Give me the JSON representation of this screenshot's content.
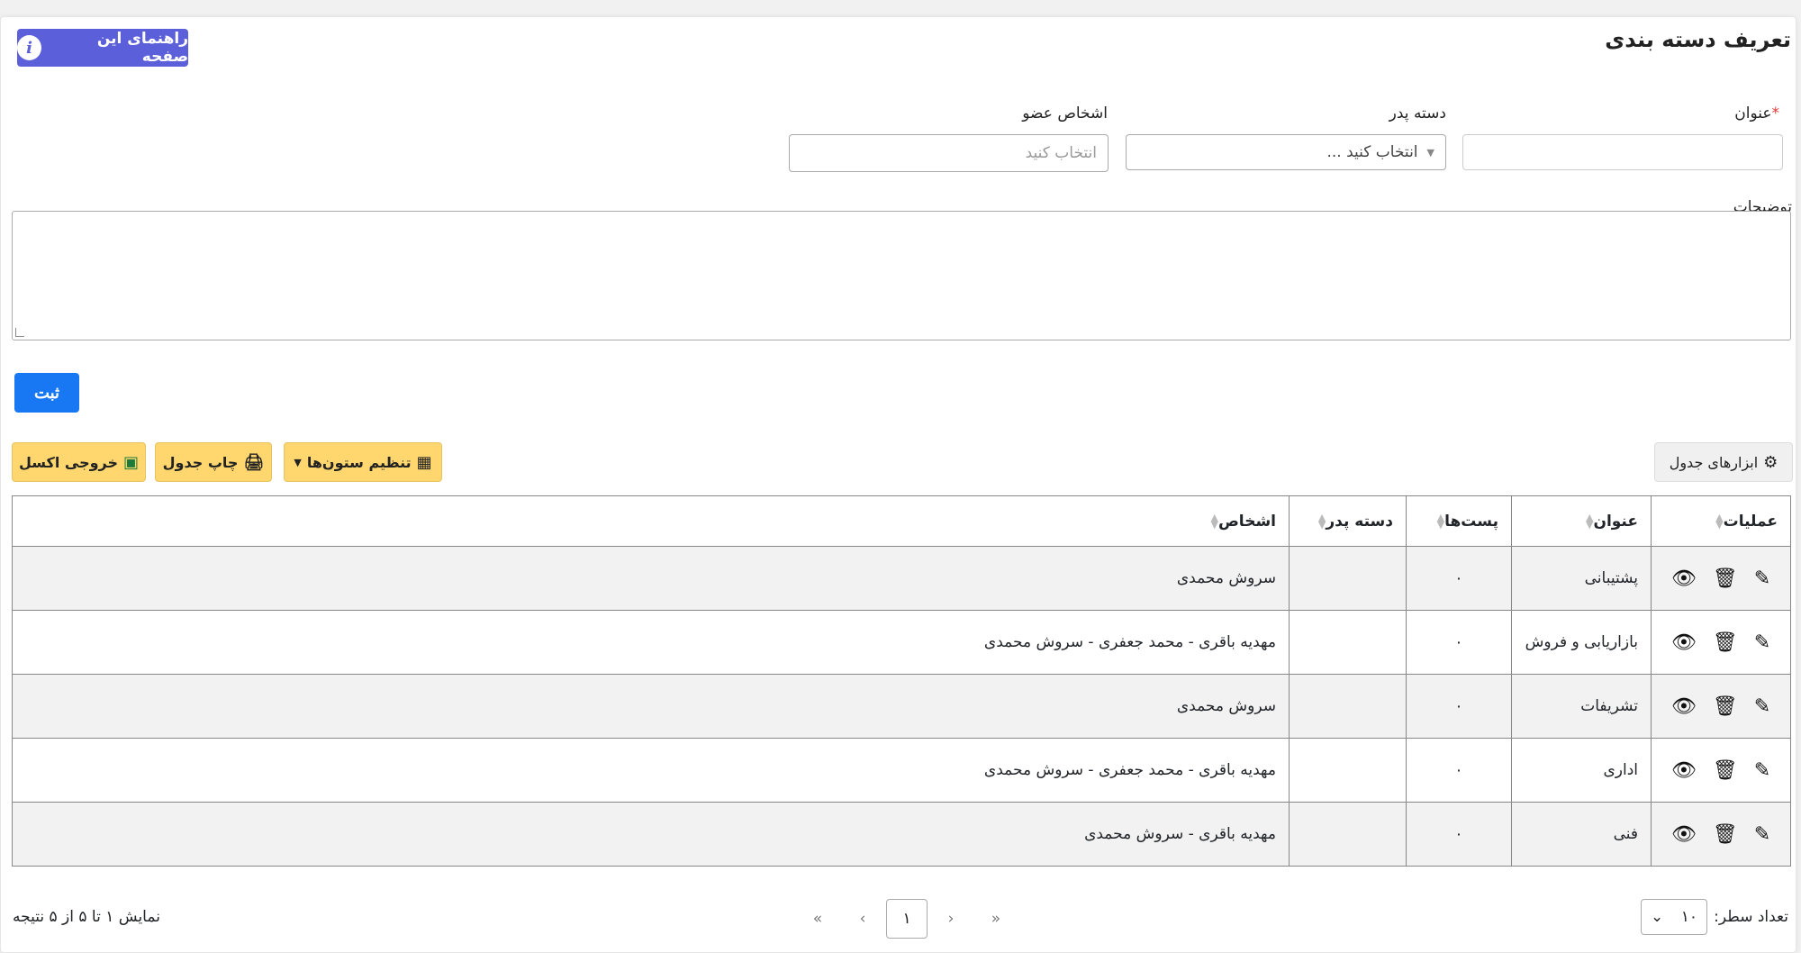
{
  "page": {
    "title": "تعریف دسته بندی",
    "help_button": "راهنمای این صفحه"
  },
  "form": {
    "title_label": "عنوان",
    "required_mark": "*",
    "parent_label": "دسته پدر",
    "parent_placeholder": "انتخاب کنید ...",
    "members_label": "اشخاص عضو",
    "members_placeholder": "انتخاب کنید",
    "description_label": "توضیحات",
    "submit_label": "ثبت"
  },
  "toolbar": {
    "table_tools": "ابزارهای جدول",
    "column_settings": "تنظیم ستون‌ها",
    "print_table": "چاپ جدول",
    "excel_export": "خروجی اکسل"
  },
  "table": {
    "headers": {
      "operations": "عملیات",
      "title": "عنوان",
      "posts": "پست‌ها",
      "parent": "دسته پدر",
      "persons": "اشخاص"
    },
    "rows": [
      {
        "title": "پشتیبانی",
        "posts": "۰",
        "parent": "",
        "persons": "سروش محمدی"
      },
      {
        "title": "بازاریابی و فروش",
        "posts": "۰",
        "parent": "",
        "persons": "مهدیه باقری - محمد جعفری - سروش محمدی"
      },
      {
        "title": "تشریفات",
        "posts": "۰",
        "parent": "",
        "persons": "سروش محمدی"
      },
      {
        "title": "اداری",
        "posts": "۰",
        "parent": "",
        "persons": "مهدیه باقری - محمد جعفری - سروش محمدی"
      },
      {
        "title": "فنی",
        "posts": "۰",
        "parent": "",
        "persons": "مهدیه باقری - سروش محمدی"
      }
    ]
  },
  "footer": {
    "rows_per_page_label": "تعداد سطر:",
    "rows_per_page_value": "۱۰",
    "current_page": "۱",
    "first": "«",
    "prev": "‹",
    "next": "›",
    "last": "»",
    "results_text": "نمایش ۱ تا ۵ از ۵ نتیجه"
  },
  "colors": {
    "help_button": "#5b5fd9",
    "submit_button": "#1877f2",
    "yellow_buttons": "#ffd76e",
    "required": "#e23a3a"
  }
}
